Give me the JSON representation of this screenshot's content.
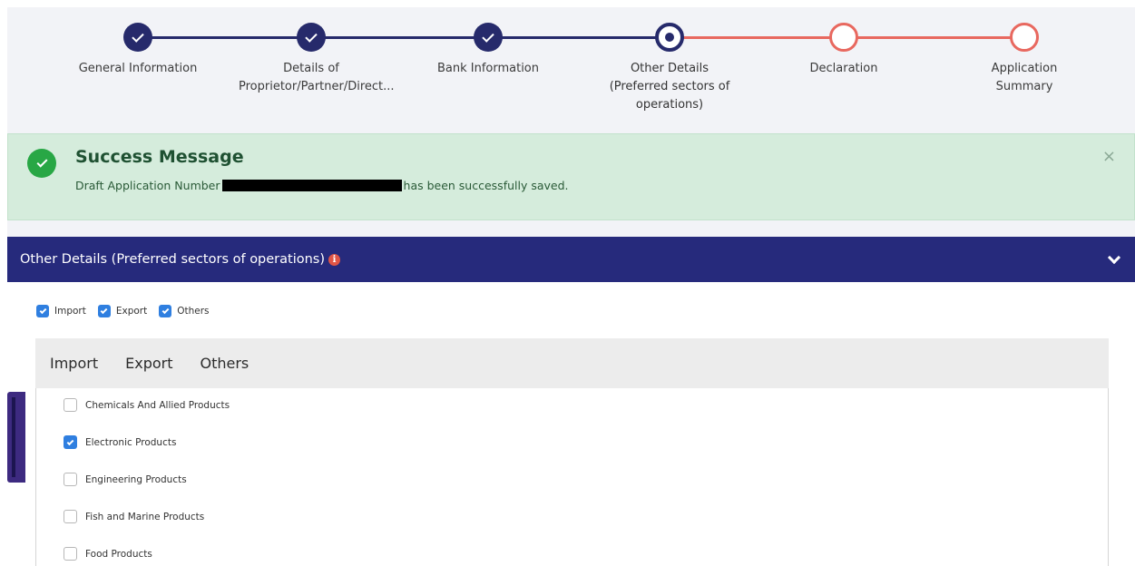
{
  "stepper": {
    "steps": [
      {
        "label": "General Information",
        "state": "done"
      },
      {
        "label": "Details of Proprietor/Partner/Direct...",
        "state": "done"
      },
      {
        "label": "Bank Information",
        "state": "done"
      },
      {
        "label": "Other Details (Preferred sectors of operations)",
        "state": "current"
      },
      {
        "label": "Declaration",
        "state": "todo"
      },
      {
        "label": "Application Summary",
        "state": "todo"
      }
    ],
    "colors": {
      "done": "#262a6b",
      "todo": "#e8685f"
    }
  },
  "alert": {
    "title": "Success Message",
    "body_prefix": "Draft Application Number",
    "body_suffix": "has been successfully saved.",
    "close_label": "×"
  },
  "section": {
    "title": "Other Details (Preferred sectors of operations)",
    "info_label": "i"
  },
  "top_checks": [
    {
      "label": "Import",
      "checked": true
    },
    {
      "label": "Export",
      "checked": true
    },
    {
      "label": "Others",
      "checked": true
    }
  ],
  "tabs": [
    "Import",
    "Export",
    "Others"
  ],
  "products": [
    {
      "label": "Chemicals And Allied Products",
      "checked": false
    },
    {
      "label": "Electronic Products",
      "checked": true
    },
    {
      "label": "Engineering Products",
      "checked": false
    },
    {
      "label": "Fish and Marine Products",
      "checked": false
    },
    {
      "label": "Food Products",
      "checked": false
    }
  ]
}
